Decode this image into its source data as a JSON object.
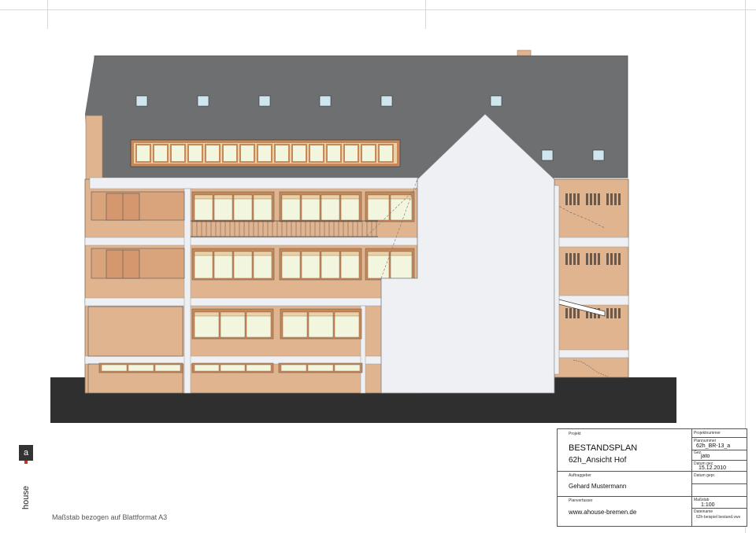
{
  "footer": {
    "scale_note": "Maßstab bezogen auf Blattformat A3"
  },
  "logo": {
    "text": "ahouse"
  },
  "title_block": {
    "projekt_label": "Projekt",
    "projektnummer_label": "Projektnummer",
    "title": "BESTANDSPLAN",
    "subtitle": "62h_Ansicht Hof",
    "plannummer_label": "Plannummer",
    "plannummer": "62h_BR-13_a",
    "gez_label": "Gez.",
    "gez": "jato",
    "datum_gez_label": "Datum gez.",
    "datum_gez": "15.12.2010",
    "datum_gepr_label": "Datum gepr.",
    "auftraggeber_label": "Auftraggeber",
    "auftraggeber": "Gehard Mustermann",
    "planverfasser_label": "Planverfasser",
    "planverfasser": "www.ahouse-bremen.de",
    "massstab_label": "Maßstab",
    "massstab": "1:100",
    "dateiname_label": "Dateiname",
    "dateiname": "62h-beispiel bestand.vwx"
  },
  "colors": {
    "roof": "#6e6f71",
    "facade": "#e0b48f",
    "window_frame": "#c8895a",
    "glass": "#f2f6df",
    "gable": "#eef0f3",
    "ground": "#2f2f2f",
    "skylight": "#cfe6ee"
  }
}
